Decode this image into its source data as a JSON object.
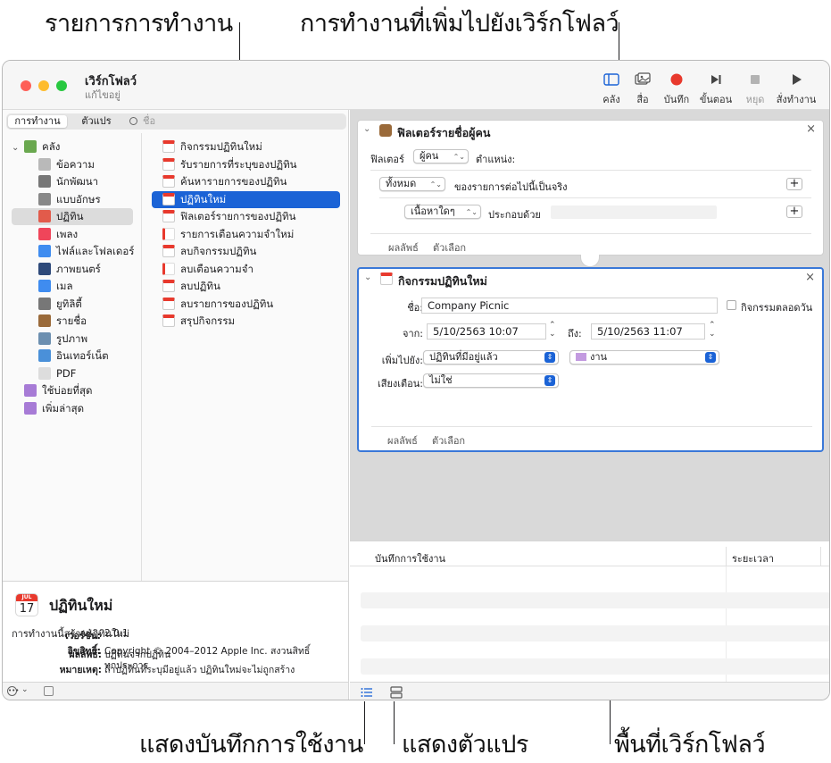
{
  "callouts": {
    "actions_list": "รายการการทำงาน",
    "added_actions": "การทำงานที่เพิ่มไปยังเวิร์กโฟลว์",
    "show_log": "แสดงบันทึกการใช้งาน",
    "show_variables": "แสดงตัวแปร",
    "workflow_area": "พื้นที่เวิร์กโฟลว์"
  },
  "window": {
    "title": "เวิร์กโฟลว์",
    "subtitle": "แก้ไขอยู่"
  },
  "toolbar": {
    "library": "คลัง",
    "media": "สื่อ",
    "record": "บันทึก",
    "step": "ขั้นตอน",
    "stop": "หยุด",
    "run": "สั่งทำงาน"
  },
  "sidebar": {
    "tab_actions": "การทำงาน",
    "tab_variables": "ตัวแปร",
    "search_placeholder": "ชื่อ",
    "library": [
      {
        "label": "คลัง",
        "icon": "library-icon",
        "color": "#6aa84f"
      },
      {
        "label": "ข้อความ",
        "icon": "text-icon",
        "color": "#b9b9b9"
      },
      {
        "label": "นักพัฒนา",
        "icon": "developer-icon",
        "color": "#777777"
      },
      {
        "label": "แบบอักษร",
        "icon": "fonts-icon",
        "color": "#888888"
      },
      {
        "label": "ปฏิทิน",
        "icon": "calendar-icon",
        "color": "#e25b4b"
      },
      {
        "label": "เพลง",
        "icon": "music-icon",
        "color": "#f0455a"
      },
      {
        "label": "ไฟล์และโฟลเดอร์",
        "icon": "finder-icon",
        "color": "#3f8cf0"
      },
      {
        "label": "ภาพยนตร์",
        "icon": "movie-icon",
        "color": "#2e4a7a"
      },
      {
        "label": "เมล",
        "icon": "mail-icon",
        "color": "#3f8cf0"
      },
      {
        "label": "ยูทิลิตี้",
        "icon": "utilities-icon",
        "color": "#777777"
      },
      {
        "label": "รายชื่อ",
        "icon": "contacts-icon",
        "color": "#9a6a3a"
      },
      {
        "label": "รูปภาพ",
        "icon": "photos-icon",
        "color": "#6c8fb0"
      },
      {
        "label": "อินเทอร์เน็ต",
        "icon": "internet-icon",
        "color": "#4a90d9"
      },
      {
        "label": "PDF",
        "icon": "pdf-icon",
        "color": "#dddddd"
      },
      {
        "label": "ใช้บ่อยที่สุด",
        "icon": "smart-folder-icon",
        "color": "#a77bd6"
      },
      {
        "label": "เพิ่มล่าสุด",
        "icon": "smart-folder-icon",
        "color": "#a77bd6"
      }
    ],
    "actions": [
      "กิจกรรมปฏิทินใหม่",
      "รับรายการที่ระบุของปฏิทิน",
      "ค้นหารายการของปฏิทิน",
      "ปฏิทินใหม่",
      "ฟิลเตอร์รายการของปฏิทิน",
      "รายการเตือนความจำใหม่",
      "ลบกิจกรรมปฏิทิน",
      "ลบเตือนความจำ",
      "ลบปฏิทิน",
      "ลบรายการของปฏิทิน",
      "สรุปกิจกรรม"
    ]
  },
  "description": {
    "month": "JUL",
    "day": "17",
    "title": "ปฏิทินใหม่",
    "summary": "การทำงานนี้สร้างปฏิทินใหม่",
    "result_label": "ผลลัพธ์:",
    "result_value": "ปฏิทินจากปฏิทิน",
    "note_label": "หมายเหตุ:",
    "note_value": "ถ้าปฏิทินที่ระบุมีอยู่แล้ว ปฏิทินใหม่จะไม่ถูกสร้าง",
    "version_label": "เวอร์ชั่น:",
    "version_value": "2.0.1",
    "copyright_label": "ลิขสิทธิ์:",
    "copyright_line1": "Copyright © 2004–2012 Apple Inc.  สงวนสิทธิ์",
    "copyright_line2": "ทุกประการ"
  },
  "filter_action": {
    "title": "ฟิลเตอร์รายชื่อผู้คน",
    "filter_label": "ฟิลเตอร์",
    "filter_value": "ผู้คน",
    "position_label": "ตำแหน่ง:",
    "all_value": "ทั้งหมด",
    "condition_text": "ของรายการต่อไปนี้เป็นจริง",
    "content_value": "เนื้อหาใดๆ",
    "contains_text": "ประกอบด้วย",
    "results_tab": "ผลลัพธ์",
    "options_tab": "ตัวเลือก"
  },
  "event_action": {
    "title": "กิจกรรมปฏิทินใหม่",
    "name_label": "ชื่อ:",
    "name_value": "Company Picnic",
    "allday_label": "กิจกรรมตลอดวัน",
    "from_label": "จาก:",
    "from_value": "5/10/2563 10:07",
    "to_label": "ถึง:",
    "to_value": "5/10/2563 11:07",
    "add_to_label": "เพิ่มไปยัง:",
    "add_to_value": "ปฏิทินที่มีอยู่แล้ว",
    "calendar_value": "งาน",
    "calendar_color": "#c39be0",
    "alarm_label": "เสียงเตือน:",
    "alarm_value": "ไม่ใช่",
    "results_tab": "ผลลัพธ์",
    "options_tab": "ตัวเลือก"
  },
  "log": {
    "col_log": "บันทึกการใช้งาน",
    "col_duration": "ระยะเวลา"
  },
  "colors": {
    "accent": "#1b63d6",
    "traffic_red": "#fe5f57",
    "traffic_yellow": "#febc2e",
    "traffic_green": "#28c840",
    "record_red": "#e8392d"
  }
}
